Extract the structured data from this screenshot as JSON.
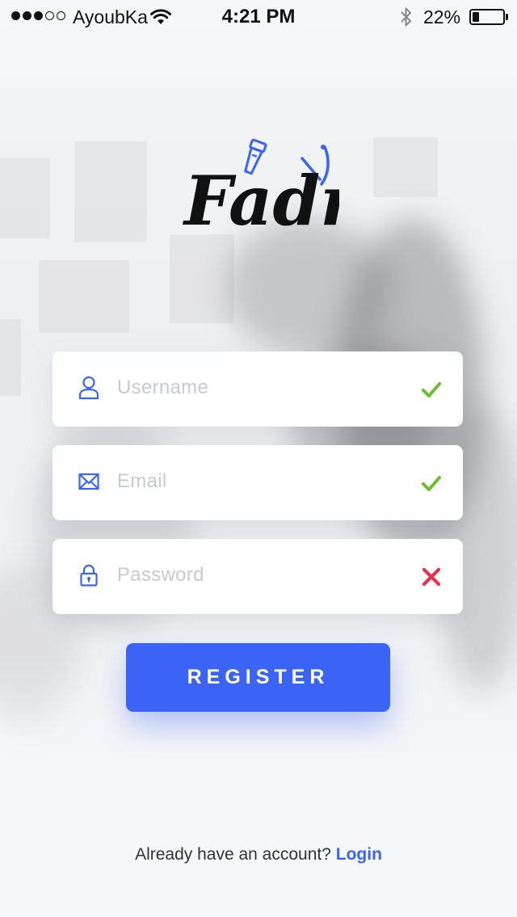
{
  "status_bar": {
    "carrier": "AyoubKa",
    "time": "4:21 PM",
    "battery": "22%",
    "signal_bars_filled": 3,
    "signal_bars_total": 5,
    "battery_level": 0.22
  },
  "logo": {
    "text": "Fadr",
    "icons": [
      "clipper-icon",
      "razor-icon"
    ]
  },
  "form": {
    "username": {
      "placeholder": "Username",
      "value": "",
      "icon": "user-icon",
      "status": "valid",
      "status_icon": "checkmark-icon"
    },
    "email": {
      "placeholder": "Email",
      "value": "",
      "icon": "envelope-icon",
      "status": "valid",
      "status_icon": "checkmark-icon"
    },
    "password": {
      "placeholder": "Password",
      "value": "",
      "icon": "lock-icon",
      "status": "invalid",
      "status_icon": "cross-icon"
    }
  },
  "register_label": "REGISTER",
  "footer": {
    "prompt": "Already have an account?",
    "login_label": "Login"
  },
  "colors": {
    "accent": "#3b64f7",
    "valid": "#6cbf2e",
    "invalid": "#e8304f",
    "placeholder": "#c7cad1"
  }
}
